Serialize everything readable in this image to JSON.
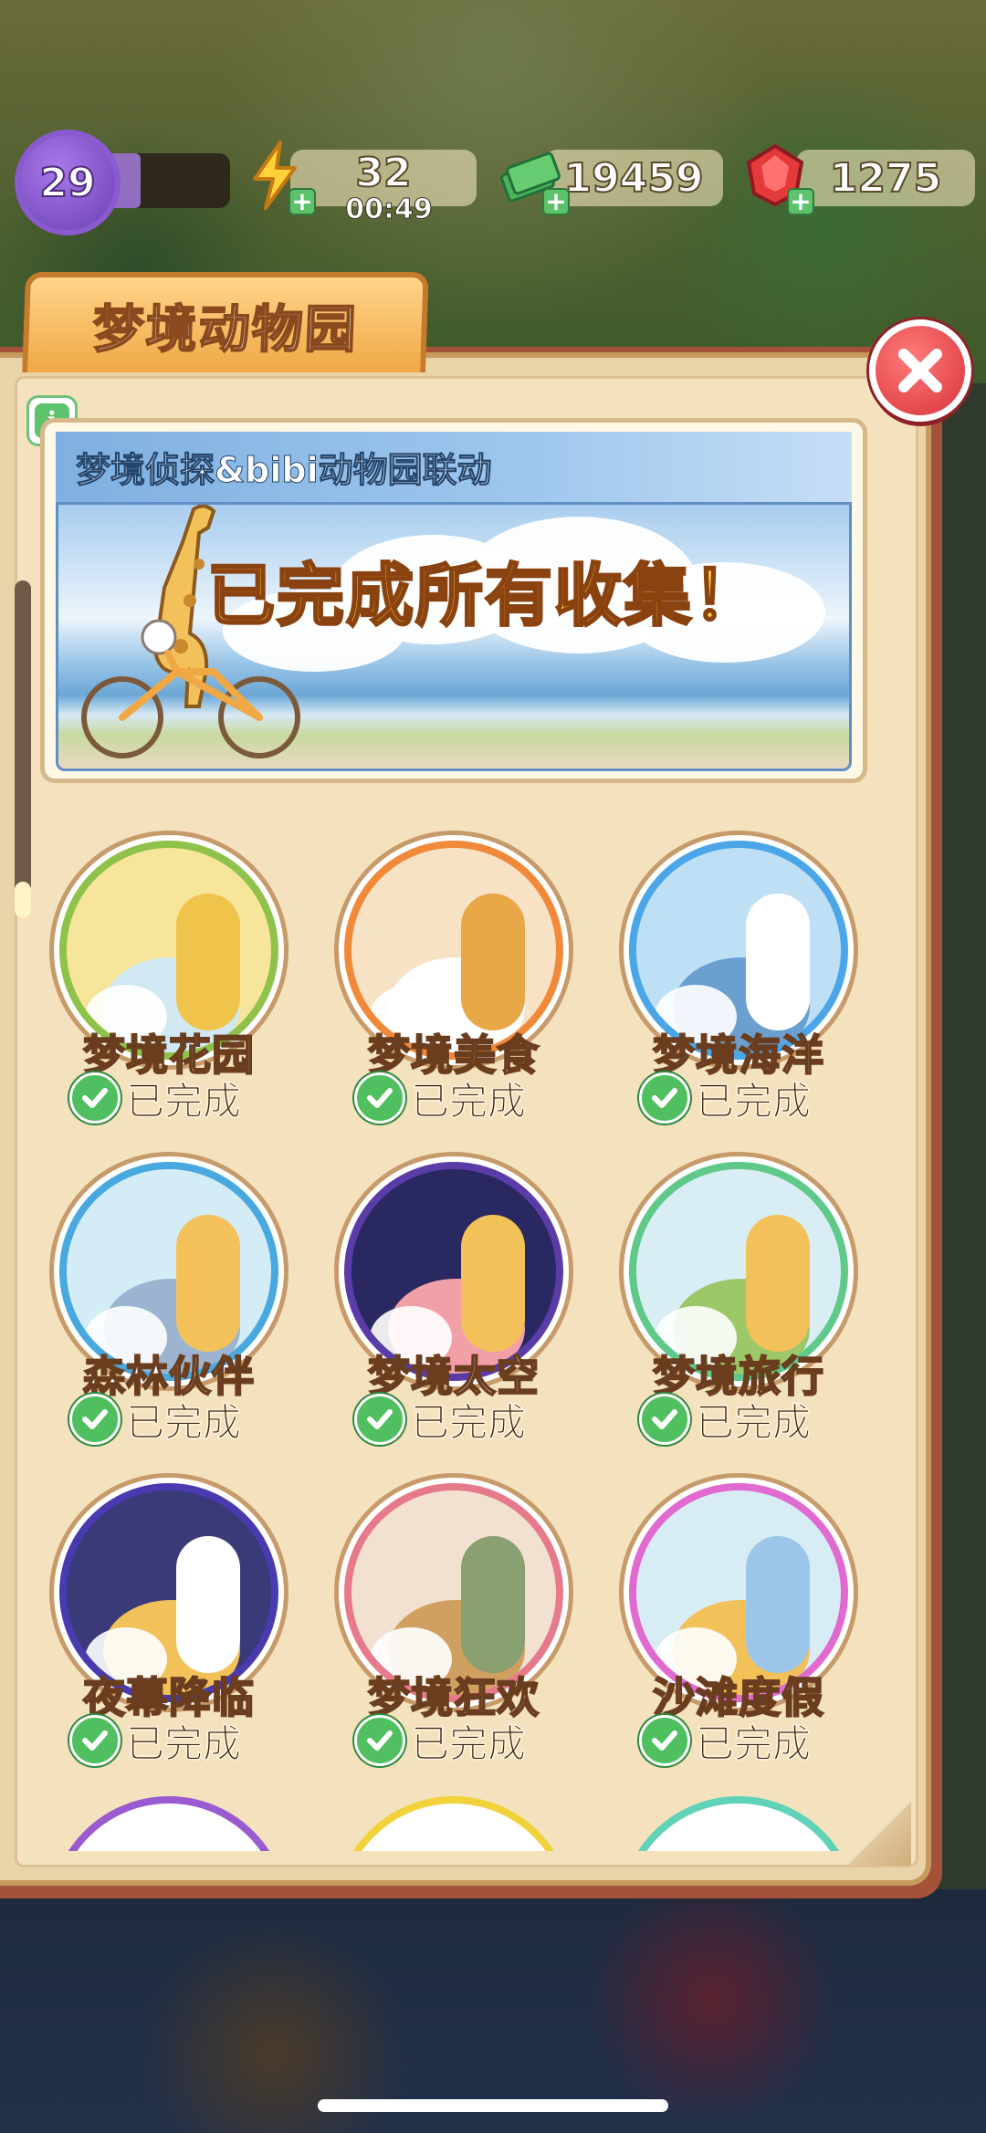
{
  "hud": {
    "level": "29",
    "energy": "32",
    "energy_timer": "00:49",
    "cash": "19459",
    "gems": "1275",
    "level_progress": 0.3
  },
  "panel": {
    "title": "梦境动物园",
    "banner": {
      "title": "梦境侦探&bibi动物园联动",
      "message": "已完成所有收集！"
    }
  },
  "collections": [
    {
      "name": "梦境花园",
      "status": "已完成",
      "ring": "#8fc24a"
    },
    {
      "name": "梦境美食",
      "status": "已完成",
      "ring": "#f08a3a"
    },
    {
      "name": "梦境海洋",
      "status": "已完成",
      "ring": "#4aa6e8"
    },
    {
      "name": "森林伙伴",
      "status": "已完成",
      "ring": "#48a8e0"
    },
    {
      "name": "梦境太空",
      "status": "已完成",
      "ring": "#5a3ca8"
    },
    {
      "name": "梦境旅行",
      "status": "已完成",
      "ring": "#5fc98a"
    },
    {
      "name": "夜幕降临",
      "status": "已完成",
      "ring": "#4a3ab0"
    },
    {
      "name": "梦境狂欢",
      "status": "已完成",
      "ring": "#e77a8a"
    },
    {
      "name": "沙滩度假",
      "status": "已完成",
      "ring": "#e06ad0"
    }
  ],
  "icons": {
    "energy": "lightning-icon",
    "cash": "cash-icon",
    "gem": "gem-icon",
    "check": "check-icon",
    "close": "close-icon",
    "info": "info-icon"
  }
}
